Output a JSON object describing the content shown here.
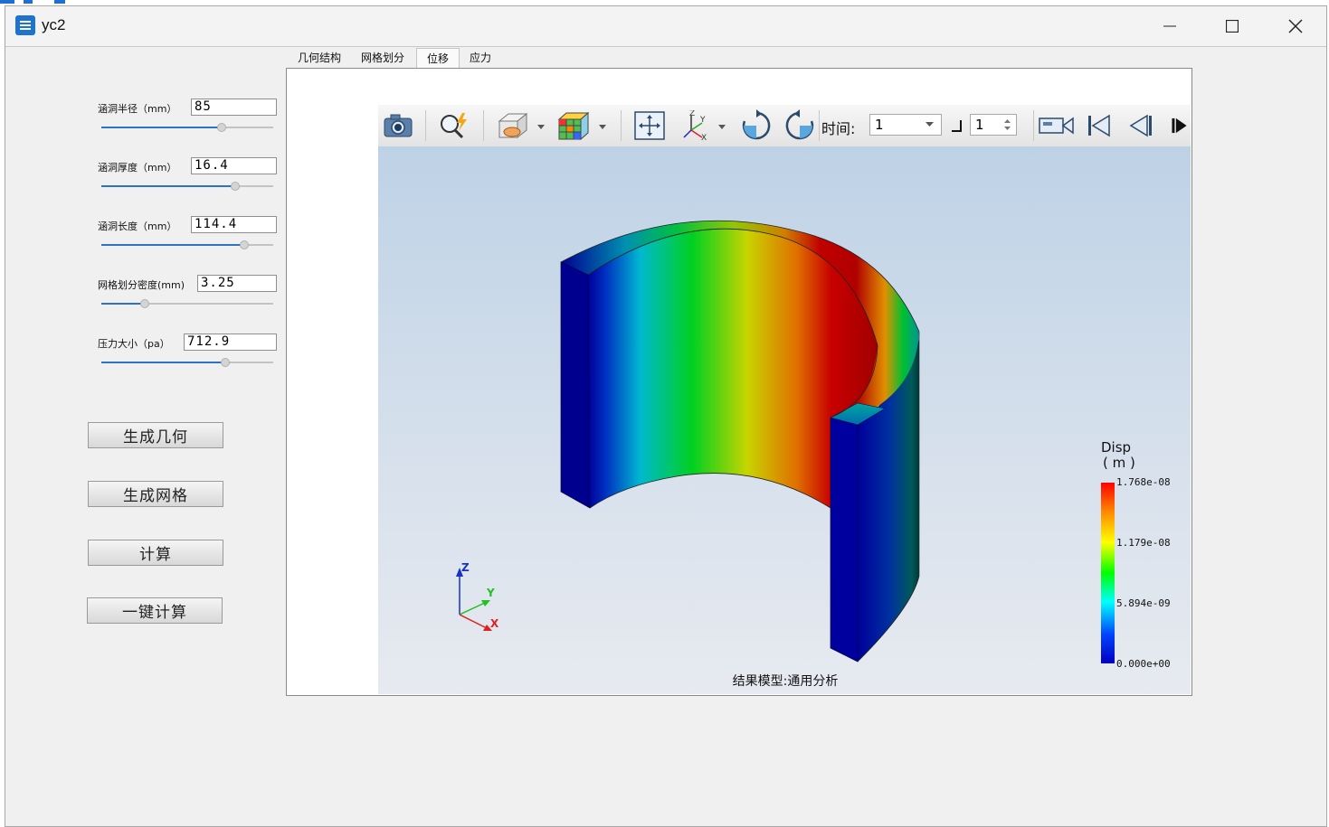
{
  "window": {
    "title": "yc2",
    "minimize_icon": "minimize-icon",
    "maximize_icon": "maximize-icon",
    "close_icon": "close-icon"
  },
  "params": [
    {
      "label": "涵洞半径（mm）",
      "value": "85",
      "slider_fraction": 0.7
    },
    {
      "label": "涵洞厚度（mm）",
      "value": "16.4",
      "slider_fraction": 0.78
    },
    {
      "label": "涵洞长度（mm）",
      "value": "114.4",
      "slider_fraction": 0.83
    },
    {
      "label": "网格划分密度(mm)",
      "value": "3.25",
      "slider_fraction": 0.25
    },
    {
      "label": "压力大小（pa）",
      "value": "712.9",
      "slider_fraction": 0.72
    }
  ],
  "buttons": {
    "gen_geometry": "生成几何",
    "gen_mesh": "生成网格",
    "compute": "计算",
    "one_click": "一键计算"
  },
  "tabs": [
    {
      "label": "几何结构",
      "active": false
    },
    {
      "label": "网格划分",
      "active": false
    },
    {
      "label": "位移",
      "active": true
    },
    {
      "label": "应力",
      "active": false
    }
  ],
  "toolbar": {
    "icons": [
      "camera-icon",
      "zoom-magic-icon",
      "clip-plane-icon",
      "mesh-cube-icon",
      "fit-view-icon",
      "axes-icon",
      "rotate-cw-icon",
      "rotate-ccw-icon",
      "video-camera-icon",
      "first-frame-icon",
      "prev-frame-icon",
      "play-icon"
    ],
    "time_label": "时间:",
    "time_value": "1",
    "step_value": "1"
  },
  "viewer": {
    "caption": "结果模型:通用分析",
    "legend": {
      "title": "Disp",
      "unit": "( m )",
      "ticks": [
        "1.768e-08",
        "1.179e-08",
        "5.894e-09",
        "0.000e+00"
      ]
    },
    "axes": {
      "x": "X",
      "y": "Y",
      "z": "Z"
    }
  },
  "colors": {
    "accent": "#1e73d2",
    "slider_fill": "#2a73c5"
  }
}
